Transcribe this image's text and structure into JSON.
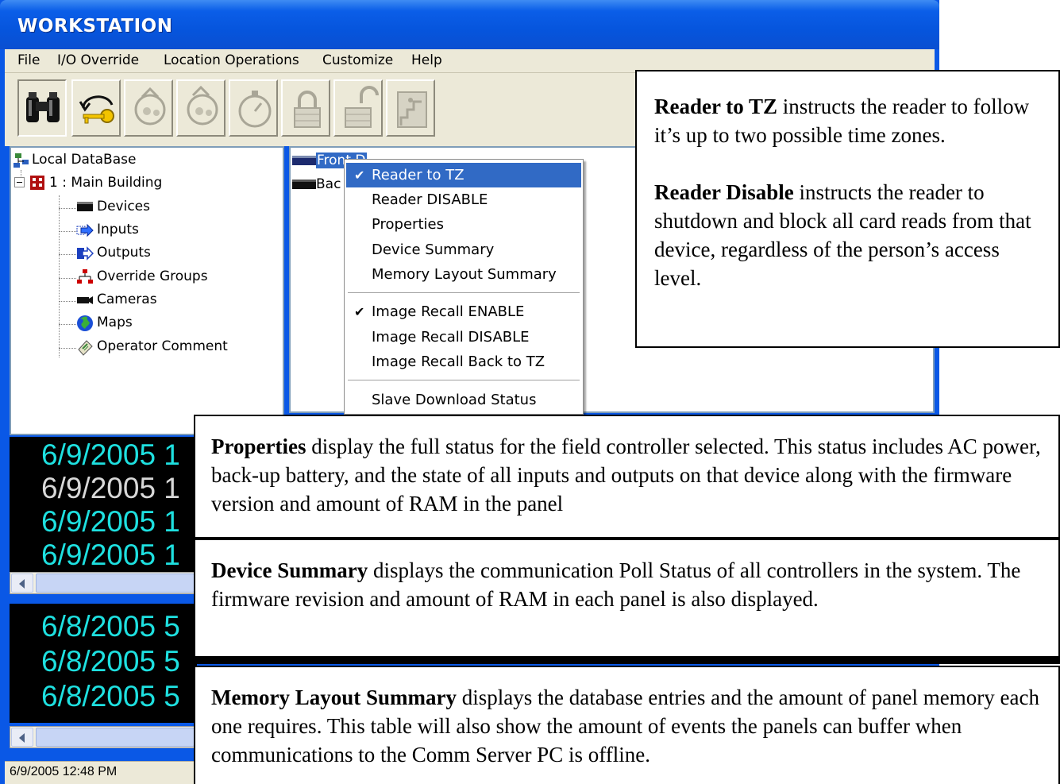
{
  "window": {
    "title": "WORKSTATION"
  },
  "menu": [
    "File",
    "I/O Override",
    "Location Operations",
    "Customize",
    "Help"
  ],
  "toolbar": {
    "buttons": [
      {
        "icon": "binoculars-icon",
        "state": "enabled"
      },
      {
        "icon": "key-login-icon",
        "state": "enabled"
      },
      {
        "icon": "guard-tour-icon",
        "state": "disabled"
      },
      {
        "icon": "guard-tour-2-icon",
        "state": "disabled"
      },
      {
        "icon": "stopwatch-icon",
        "state": "disabled"
      },
      {
        "icon": "lock-icon",
        "state": "disabled"
      },
      {
        "icon": "unlock-icon",
        "state": "disabled"
      },
      {
        "icon": "exit-door-icon",
        "state": "disabled"
      }
    ]
  },
  "tree": {
    "root": "Local DataBase",
    "building": "1 : Main Building",
    "children": [
      "Devices",
      "Inputs",
      "Outputs",
      "Override Groups",
      "Cameras",
      "Maps",
      "Operator Comment"
    ]
  },
  "devices": {
    "rows": [
      "Front D",
      "Bac"
    ]
  },
  "context_menu": {
    "items": [
      {
        "label": "Reader to TZ",
        "checked": true,
        "highlighted": true
      },
      {
        "label": "Reader DISABLE",
        "checked": false
      },
      {
        "label": "Properties",
        "checked": false
      },
      {
        "label": "Device Summary",
        "checked": false
      },
      {
        "label": "Memory Layout Summary",
        "checked": false
      },
      {
        "label": "Image Recall ENABLE",
        "checked": true
      },
      {
        "label": "Image Recall DISABLE",
        "checked": false
      },
      {
        "label": "Image Recall Back to TZ",
        "checked": false
      },
      {
        "label": "Slave Download Status",
        "checked": false
      }
    ]
  },
  "events_top": [
    {
      "text": "6/9/2005 1",
      "color": "#1ee0e0"
    },
    {
      "text": "6/9/2005 1",
      "color": "#d8d8d8"
    },
    {
      "text": "6/9/2005 1",
      "color": "#1ee0e0"
    },
    {
      "text": "6/9/2005 1",
      "color": "#1ee0e0"
    }
  ],
  "events_bottom": [
    {
      "text": "6/8/2005 5",
      "color": "#1ee0e0"
    },
    {
      "text": "6/8/2005 5",
      "color": "#1ee0e0"
    },
    {
      "text": "6/8/2005 5",
      "color": "#1ee0e0"
    }
  ],
  "status": {
    "datetime": "6/9/2005 12:48 PM"
  },
  "callouts": {
    "reader": {
      "p1_bold": "Reader to TZ",
      "p1_text": " instructs the reader to follow it’s up to two possible time zones.",
      "p2_bold": "Reader Disable",
      "p2_text": " instructs the reader to shutdown and block all card reads from that device, regardless of the person’s access level."
    },
    "properties": {
      "bold": "Properties",
      "text": " display the full status for the field controller selected. This status includes AC power, back-up battery, and the state of all inputs and outputs on that device along with the firmware version and amount of RAM in the panel"
    },
    "device_summary": {
      "bold": "Device Summary",
      "text": " displays the communication Poll Status of all controllers in the system. The firmware revision and amount of RAM in each panel is also displayed."
    },
    "memory": {
      "bold": "Memory Layout Summary",
      "text": " displays the database entries and the amount of panel memory each one requires. This table will also show the amount of events the panels can buffer when communications to the Comm Server PC is offline."
    }
  }
}
